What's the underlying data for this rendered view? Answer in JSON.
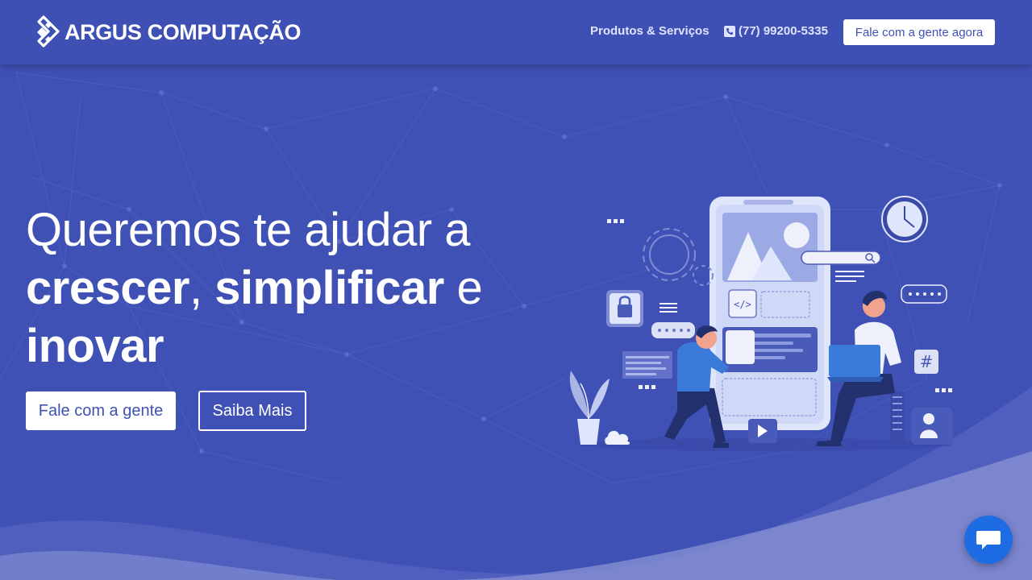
{
  "brand": {
    "name": "ARGUS COMPUTAÇÃO",
    "accent": "#3f51b5"
  },
  "nav": {
    "products_label": "Produtos & Serviços",
    "phone_label": "(77) 99200-5335",
    "cta_label": "Fale com a gente agora"
  },
  "hero": {
    "title_line1": "Queremos te ajudar a",
    "word_grow": "crescer",
    "comma": ",",
    "word_simplify": "simplificar",
    "conj": "e",
    "word_innovate": "inovar",
    "primary_button": "Fale com a gente",
    "secondary_button": "Saiba Mais"
  },
  "illustration": {
    "icons": [
      "phone-mockup",
      "gear-icon",
      "padlock-icon",
      "clock-icon",
      "search-bar",
      "code-icon",
      "hash-icon",
      "user-icon",
      "play-icon",
      "cloud-icon",
      "plant",
      "person-kneeling",
      "person-with-laptop"
    ]
  },
  "chat": {
    "icon": "chat-bubble-icon",
    "color": "#1e6ce4"
  }
}
